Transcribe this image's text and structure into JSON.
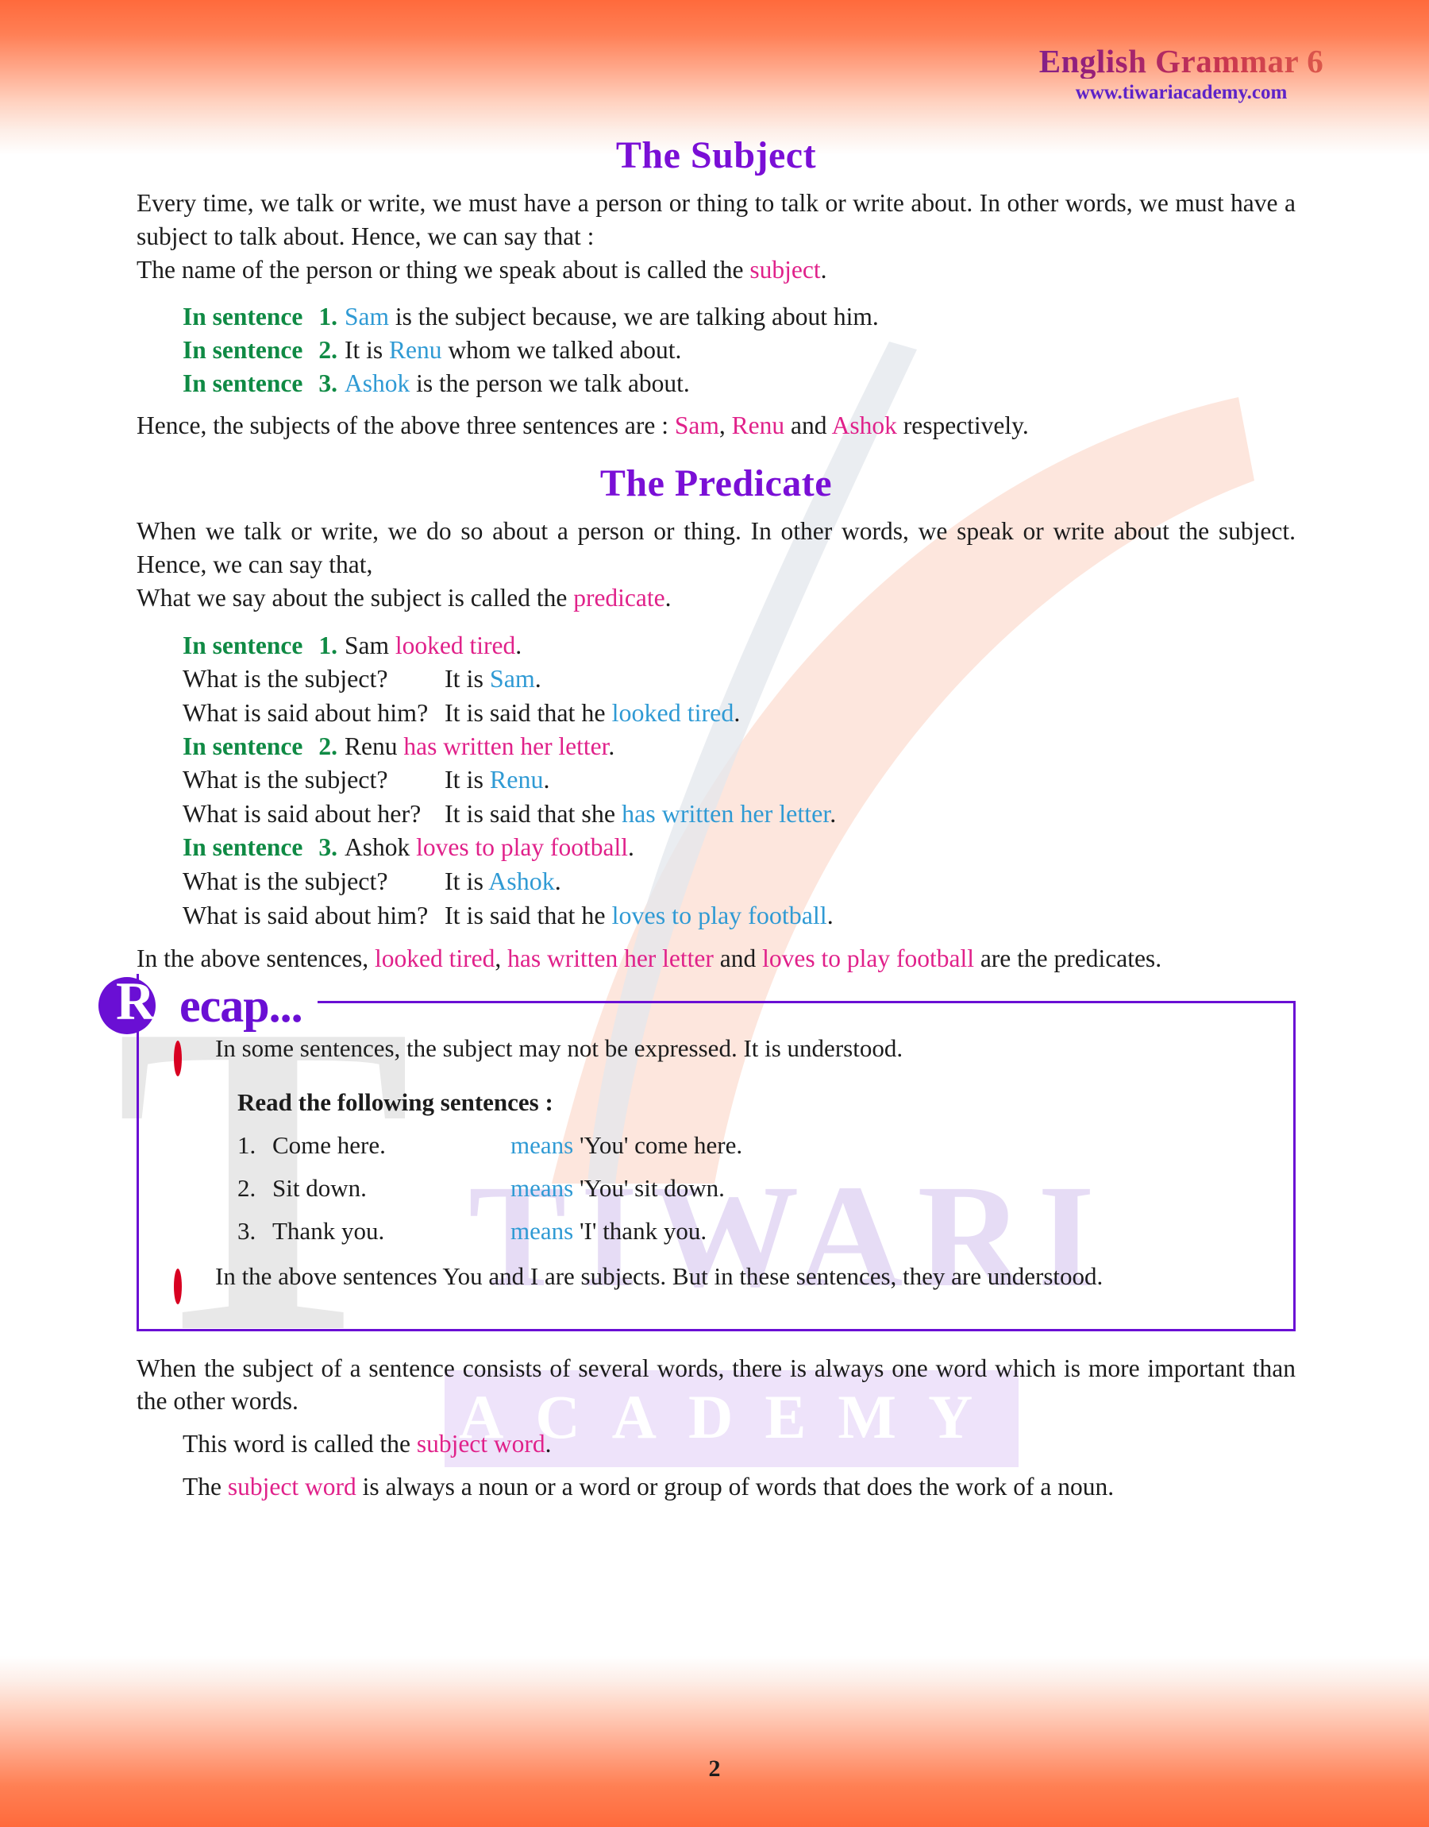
{
  "header": {
    "brand_title": "English Grammar 6",
    "brand_url": "www.tiwariacademy.com"
  },
  "watermark": {
    "word_main": "TIWARI",
    "word_sub": "ACADEMY",
    "big_letter": "T"
  },
  "colors": {
    "heading_purple": "#7a0fd6",
    "accent_green": "#0f8a44",
    "accent_blue": "#2f9ad4",
    "accent_pink": "#e0218a",
    "recap_purple": "#6a0fd4",
    "bullet_red": "#d80021",
    "gradient_orange": "#ff6a3c"
  },
  "subject_section": {
    "title": "The Subject",
    "intro_para": "Every time, we talk or write, we must have a person or thing to talk or write about. In other words, we must have a subject to talk about. Hence, we can say that :",
    "definition_pre": "The name of the person or thing we speak about is called the ",
    "definition_term": "subject",
    "definition_post": ".",
    "label_in_sentence": "In sentence",
    "examples": [
      {
        "num": "1.",
        "subject": "Sam",
        "rest": " is the subject because, we are talking about him."
      },
      {
        "num": "2.",
        "lead": "It is ",
        "subject": "Renu",
        "rest": " whom we talked about."
      },
      {
        "num": "3.",
        "subject": "Ashok",
        "rest": " is the person we talk about."
      }
    ],
    "summary_pre": "Hence, the subjects of the above three sentences are : ",
    "summary_names": [
      "Sam",
      "Renu",
      "Ashok"
    ],
    "summary_sep1": ", ",
    "summary_sep2": " and ",
    "summary_post": " respectively."
  },
  "predicate_section": {
    "title": "The Predicate",
    "intro_para": "When we talk or write, we do so about a person or thing. In other words, we speak or write about the subject. Hence, we can say that,",
    "definition_pre": "What we say about the subject is called the ",
    "definition_term": "predicate",
    "definition_post": ".",
    "label_in_sentence": "In sentence",
    "blocks": [
      {
        "num": "1.",
        "subject": "Sam ",
        "predicate": "looked tired",
        "period": ".",
        "q1": "What is the subject?",
        "a1_pre": "It is ",
        "a1_val": "Sam",
        "a1_post": ".",
        "q2": "What is said about him?",
        "a2_pre": "It is said that he ",
        "a2_val": "looked tired",
        "a2_post": "."
      },
      {
        "num": "2.",
        "subject": "Renu ",
        "predicate": "has written her letter",
        "period": ".",
        "q1": "What is the subject?",
        "a1_pre": "It is ",
        "a1_val": "Renu",
        "a1_post": ".",
        "q2": "What is said about her?",
        "a2_pre": "It is said that she ",
        "a2_val": "has written her letter",
        "a2_post": "."
      },
      {
        "num": "3.",
        "subject": "Ashok ",
        "predicate": "loves to play football",
        "period": ".",
        "q1": "What is the subject?",
        "a1_pre": "It is ",
        "a1_val": "Ashok",
        "a1_post": ".",
        "q2": "What is said about him?",
        "a2_pre": "It is said that he ",
        "a2_val": "loves to play football",
        "a2_post": "."
      }
    ],
    "closing_pre": "In the above sentences, ",
    "closing_terms": [
      "looked tired",
      "has written her letter",
      "loves to play football"
    ],
    "closing_sep1": ", ",
    "closing_sep2": " and ",
    "closing_post": " are the predicates."
  },
  "recap": {
    "badge_letter": "R",
    "badge_rest": "ecap...",
    "bullet_1": "In some sentences, the subject may not be expressed. It is understood.",
    "sub_heading": "Read the following sentences :",
    "items": [
      {
        "num": "1.",
        "sentence": "Come here.",
        "means": "means",
        "explain": " 'You' come here."
      },
      {
        "num": "2.",
        "sentence": "Sit down.",
        "means": "means",
        "explain": " 'You' sit down."
      },
      {
        "num": "3.",
        "sentence": "Thank you.",
        "means": "means",
        "explain": " 'I' thank you."
      }
    ],
    "bullet_2": "In the above sentences You and I are subjects. But in these sentences, they are understood."
  },
  "closing_section": {
    "para": "When the subject of a sentence consists of several words, there is always one word which is more important than the other words.",
    "line1_pre": "This word is called the ",
    "line1_term": "subject word",
    "line1_post": ".",
    "line2_pre": "The ",
    "line2_term": "subject word",
    "line2_post": " is always a noun or a word or group of words that does the work of a noun."
  },
  "footer": {
    "page_number": "2"
  }
}
